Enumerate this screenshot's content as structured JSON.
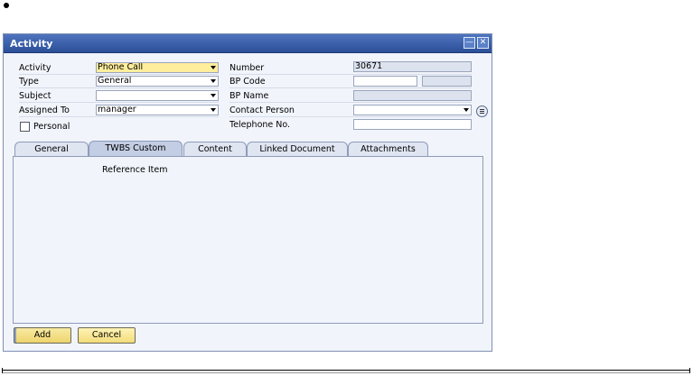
{
  "window": {
    "title": "Activity",
    "minimize_icon": "minimize-icon",
    "close_icon": "close-icon"
  },
  "form": {
    "activity": {
      "label": "Activity",
      "value": "Phone Call"
    },
    "type": {
      "label": "Type",
      "value": "General"
    },
    "subject": {
      "label": "Subject",
      "value": ""
    },
    "assigned_to": {
      "label": "Assigned To",
      "value": "manager"
    },
    "personal": {
      "label": "Personal",
      "checked": false
    },
    "number": {
      "label": "Number",
      "value": "30671"
    },
    "bp_code": {
      "label": "BP Code",
      "value": "",
      "value2": ""
    },
    "bp_name": {
      "label": "BP Name",
      "value": ""
    },
    "contact_person": {
      "label": "Contact Person",
      "value": ""
    },
    "telephone": {
      "label": "Telephone No.",
      "value": ""
    }
  },
  "tabs": [
    {
      "label": "General",
      "active": false
    },
    {
      "label": "TWBS Custom",
      "active": true
    },
    {
      "label": "Content",
      "active": false
    },
    {
      "label": "Linked Document",
      "active": false
    },
    {
      "label": "Attachments",
      "active": false
    }
  ],
  "panel": {
    "reference_item_label": "Reference Item"
  },
  "buttons": {
    "add": "Add",
    "cancel": "Cancel"
  },
  "colors": {
    "title_bar": "#3a5fa8",
    "mandatory_field": "#ffee9c",
    "readonly_field": "#dde3ee",
    "button": "#f2dc7a"
  }
}
